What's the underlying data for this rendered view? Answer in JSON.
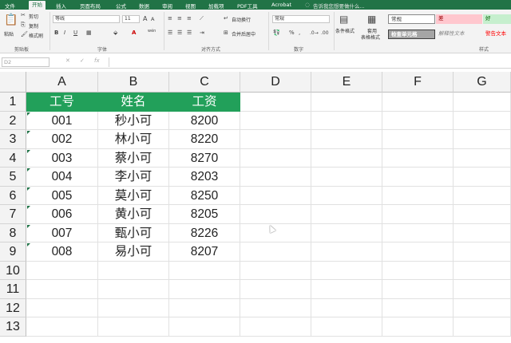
{
  "menubar": {
    "tabs": [
      "文件",
      "开始",
      "插入",
      "页面布局",
      "公式",
      "数据",
      "审阅",
      "视图",
      "加载项",
      "PDF工具",
      "Acrobat"
    ],
    "search": "告诉我您想要做什么..."
  },
  "ribbon": {
    "paste": "粘贴",
    "cut": "剪切",
    "copy": "复制",
    "format_painter": "格式刷",
    "clipboard": "剪贴板",
    "font_name": "等线",
    "font_size": "11",
    "bold": "B",
    "italic": "I",
    "underline": "U",
    "grow_font": "A",
    "shrink_font": "A",
    "wen": "wén",
    "font_group": "字体",
    "wrap_text": "自动换行",
    "merge_center": "合并后居中",
    "alignment_group": "对齐方式",
    "number_format": "常规",
    "percent": "%",
    "comma": ",",
    "number_group": "数字",
    "conditional_format": "条件格式",
    "format_table_1": "套用",
    "format_table_2": "表格格式",
    "styles": {
      "normal": "常规",
      "bad": "差",
      "good": "好",
      "check_cell": "检查单元格",
      "explanatory": "解释性文本",
      "warning": "警告文本"
    },
    "styles_group": "样式"
  },
  "formula_bar": {
    "name_box": "D2",
    "cancel": "✕",
    "enter": "✓",
    "fx": "fx"
  },
  "sheet": {
    "columns": [
      "A",
      "B",
      "C",
      "D",
      "E",
      "F",
      "G"
    ],
    "rows": [
      "1",
      "2",
      "3",
      "4",
      "5",
      "6",
      "7",
      "8",
      "9",
      "10",
      "11",
      "12",
      "13"
    ],
    "header": [
      "工号",
      "姓名",
      "工资"
    ],
    "data": [
      [
        "001",
        "秒小可",
        "8200"
      ],
      [
        "002",
        "林小可",
        "8220"
      ],
      [
        "003",
        "蔡小可",
        "8270"
      ],
      [
        "004",
        "李小可",
        "8203"
      ],
      [
        "005",
        "莫小可",
        "8250"
      ],
      [
        "006",
        "黄小可",
        "8205"
      ],
      [
        "007",
        "甄小可",
        "8226"
      ],
      [
        "008",
        "易小可",
        "8207"
      ]
    ]
  },
  "colors": {
    "brand": "#217346",
    "header_fill": "#22a05a",
    "bad_fill": "#ffc7ce",
    "good_fill": "#c6efce",
    "check_fill": "#a5a5a5",
    "warning_text": "#ff0000"
  }
}
